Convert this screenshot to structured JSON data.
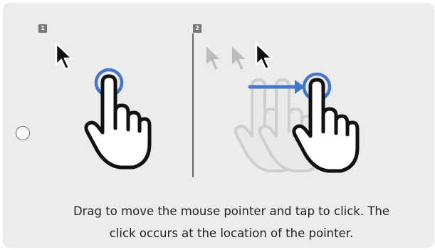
{
  "option": {
    "selected": false,
    "steps": [
      {
        "number": "1",
        "icons": [
          "mouse-pointer-icon",
          "tap-hand-icon"
        ]
      },
      {
        "number": "2",
        "icons": [
          "pointer-motion-trail-icon",
          "drag-arrow-icon",
          "drag-hand-icon"
        ]
      }
    ],
    "caption_line1": "Drag to move the mouse pointer and tap to click. The",
    "caption_line2": "click occurs at the location of the pointer."
  },
  "colors": {
    "card_background": "#ececec",
    "accent_blue": "#4477cc",
    "badge_gray": "#7a7a7a"
  }
}
